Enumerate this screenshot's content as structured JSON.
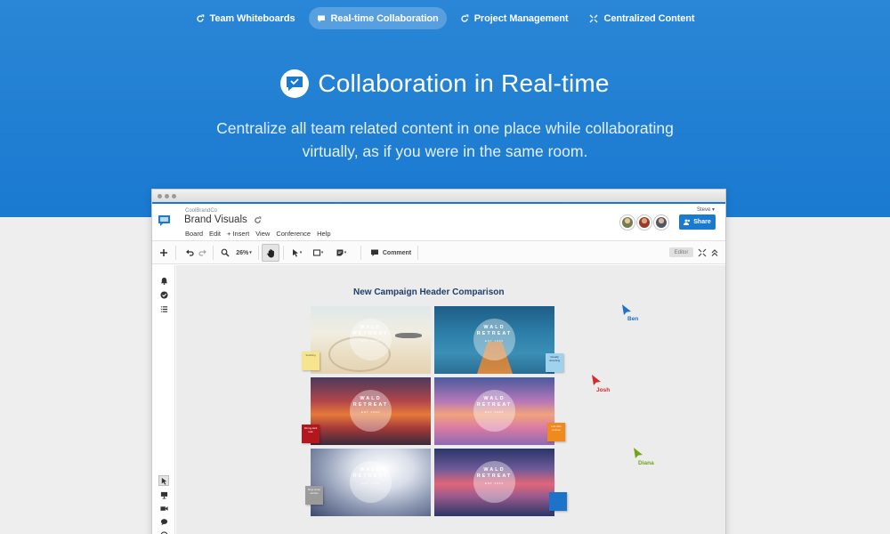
{
  "topnav": {
    "tabs": [
      {
        "label": "Team Whiteboards",
        "icon": "refresh-icon",
        "active": false
      },
      {
        "label": "Real-time Collaboration",
        "icon": "comment-icon",
        "active": true
      },
      {
        "label": "Project Management",
        "icon": "refresh-icon",
        "active": false
      },
      {
        "label": "Centralized Content",
        "icon": "collapse-icon",
        "active": false
      }
    ]
  },
  "hero": {
    "title": "Collaboration in Real-time",
    "subtitle_line1": "Centralize all team related content in one place while collaborating",
    "subtitle_line2": "virtually, as if you were in the same room."
  },
  "app": {
    "company": "CoolBrandCo",
    "board_title": "Brand Visuals",
    "user": "Steve ▾",
    "menu": [
      "Board",
      "Edit",
      "+ Insert",
      "View",
      "Conference",
      "Help"
    ],
    "share_label": "Share",
    "toolbar": {
      "zoom": "26%",
      "comment_label": "Comment",
      "editor_label": "Editor"
    },
    "board": {
      "heading": "New Campaign Header Comparison",
      "badge_line1": "WALD",
      "badge_line2": "RETREAT",
      "badge_sub": "EST 1900",
      "notes": [
        {
          "text": "Soothing",
          "color": "#f6e58c"
        },
        {
          "text": "Visually refreshing",
          "color": "#9fd2ef"
        },
        {
          "text": "Strong dark reds",
          "color": "#b3161c"
        },
        {
          "text": "Lost calm contrast",
          "color": "#f08a1c"
        },
        {
          "text": "Drop some worries",
          "color": "#9b9b9b"
        },
        {
          "text": "",
          "color": "#1b74c9"
        }
      ],
      "collaborators": [
        {
          "name": "Ben",
          "color": "#1b74c9"
        },
        {
          "name": "Josh",
          "color": "#d42a2a"
        },
        {
          "name": "Diana",
          "color": "#6fa616"
        }
      ]
    }
  },
  "colors": {
    "brand": "#1a7ad0",
    "heading": "#1e3e6b"
  }
}
